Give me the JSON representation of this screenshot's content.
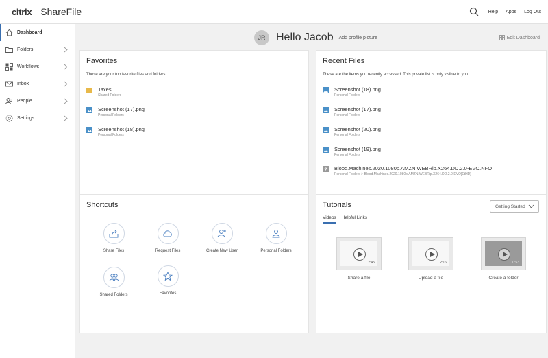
{
  "header": {
    "brand_left": "citrix",
    "brand_right": "ShareFile",
    "nav": [
      "Help",
      "Apps",
      "Log Out"
    ]
  },
  "sidebar": {
    "items": [
      {
        "label": "Dashboard",
        "icon": "home-icon"
      },
      {
        "label": "Folders",
        "icon": "folder-icon"
      },
      {
        "label": "Workflows",
        "icon": "workflows-icon"
      },
      {
        "label": "Inbox",
        "icon": "inbox-icon"
      },
      {
        "label": "People",
        "icon": "people-icon"
      },
      {
        "label": "Settings",
        "icon": "gear-icon"
      }
    ]
  },
  "greeting": {
    "initials": "JR",
    "text": "Hello Jacob",
    "add_picture": "Add profile picture",
    "edit_dashboard": "Edit Dashboard"
  },
  "favorites": {
    "title": "Favorites",
    "description": "These are your top favorite files and folders.",
    "items": [
      {
        "name": "Taxes",
        "sub": "Shared Folders",
        "type": "folder"
      },
      {
        "name": "Screenshot (17).png",
        "sub": "Personal Folders",
        "type": "image"
      },
      {
        "name": "Screenshot (18).png",
        "sub": "Personal Folders",
        "type": "image"
      }
    ]
  },
  "recent": {
    "title": "Recent Files",
    "description": "These are the items you recently accessed. This private list is only visible to you.",
    "items": [
      {
        "name": "Screenshot (18).png",
        "sub": "Personal Folders",
        "type": "image"
      },
      {
        "name": "Screenshot (17).png",
        "sub": "Personal Folders",
        "type": "image"
      },
      {
        "name": "Screenshot (20).png",
        "sub": "Personal Folders",
        "type": "image"
      },
      {
        "name": "Screenshot (19).png",
        "sub": "Personal Folders",
        "type": "image"
      },
      {
        "name": "Blood.Machines.2020.1080p.AMZN.WEBRip.X264.DD.2.0-EVO.NFO",
        "sub": "Personal Folders > Blood.Machines.2020.1080p.AMZN.WEBRip.X264.DD.2.0-EVO[EtHD]",
        "type": "unknown"
      }
    ]
  },
  "shortcuts": {
    "title": "Shortcuts",
    "items": [
      "Share Files",
      "Request Files",
      "Create New User",
      "Personal Folders",
      "Shared Folders",
      "Favorites"
    ]
  },
  "tutorials": {
    "title": "Tutorials",
    "dropdown": "Getting Started",
    "tabs": [
      "Videos",
      "Helpful Links"
    ],
    "videos": [
      {
        "label": "Share a file",
        "duration": "2:45"
      },
      {
        "label": "Upload a file",
        "duration": "2:16"
      },
      {
        "label": "Create a folder",
        "duration": "0:53"
      }
    ]
  },
  "colors": {
    "accent": "#3a6fb0",
    "image_icon": "#4a90c8",
    "folder_icon": "#e8b94a"
  }
}
